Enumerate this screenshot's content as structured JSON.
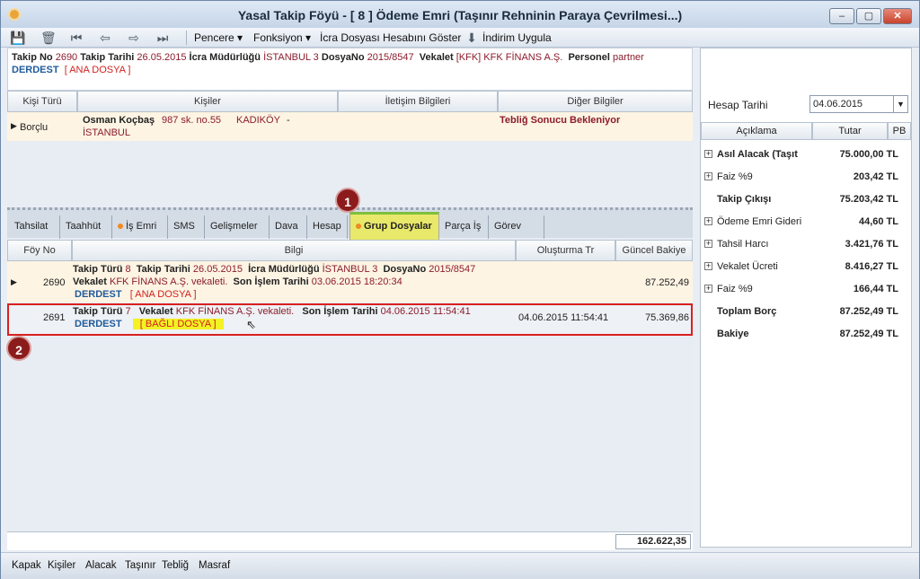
{
  "window": {
    "title": "Yasal Takip Föyü - [ 8 ] Ödeme Emri (Taşınır Rehninin Paraya Çevrilmesi...)"
  },
  "toolbar": {
    "menus": [
      "Pencere ▾",
      "Fonksiyon ▾",
      "İcra Dosyası Hesabını Göster",
      "İndirim Uygula"
    ]
  },
  "info": {
    "takip_no_label": "Takip No",
    "takip_no": "2690",
    "takip_tarihi_label": "Takip Tarihi",
    "takip_tarihi": "26.05.2015",
    "icra_label": "İcra Müdürlüğü",
    "icra": "İSTANBUL 3",
    "dosya_label": "DosyaNo",
    "dosya": "2015/8547",
    "vekalet_label": "Vekalet",
    "vekalet": "[KFK] KFK FİNANS A.Ş.",
    "personel_label": "Personel",
    "personel": "partner",
    "durum": "DERDEST",
    "ana_dosya": "[ ANA DOSYA ]"
  },
  "parties": {
    "headers": [
      "Kişi Türü",
      "Kişiler",
      "İletişim Bilgileri",
      "Diğer Bilgiler"
    ],
    "row": {
      "type": "Borçlu",
      "name": "Osman Koçbaş",
      "address": "987 sk. no.55",
      "district": "KADIKÖY",
      "dash": "-",
      "city": "İSTANBUL",
      "other": "Tebliğ Sonucu Bekleniyor"
    }
  },
  "tabs": [
    "Tahsilat",
    "Taahhüt",
    "İş Emri",
    "SMS",
    "Gelişmeler",
    "Dava",
    "Hesap",
    "Grup Dosyalar",
    "Parça İş",
    "Görev"
  ],
  "badges": {
    "b1": "1",
    "b2": "2"
  },
  "group": {
    "headers": [
      "Föy No",
      "Bilgi",
      "Oluşturma Tr",
      "Güncel Bakiye"
    ],
    "rows": [
      {
        "foy": "2690",
        "takip_turu_label": "Takip Türü",
        "takip_turu": "8",
        "takip_tarihi_label": "Takip Tarihi",
        "takip_tarihi": "26.05.2015",
        "icra_label": "İcra Müdürlüğü",
        "icra": "İSTANBUL 3",
        "dosya_label": "DosyaNo",
        "dosya": "2015/8547",
        "vekalet_label": "Vekalet",
        "vekalet": "KFK FİNANS A.Ş. vekaleti.",
        "son_label": "Son İşlem Tarihi",
        "son": "03.06.2015 18:20:34",
        "durum": "DERDEST",
        "tag": "[ ANA DOSYA ]",
        "created": "",
        "balance": "87.252,49"
      },
      {
        "foy": "2691",
        "takip_turu_label": "Takip Türü",
        "takip_turu": "7",
        "vekalet_label": "Vekalet",
        "vekalet": "KFK FİNANS A.Ş. vekaleti.",
        "son_label": "Son İşlem Tarihi",
        "son": "04.06.2015 11:54:41",
        "durum": "DERDEST",
        "tag": "[ BAĞLI DOSYA ]",
        "created": "04.06.2015 11:54:41",
        "balance": "75.369,86"
      }
    ],
    "total": "162.622,35"
  },
  "account": {
    "date_label": "Hesap Tarihi",
    "date": "04.06.2015",
    "headers": [
      "Açıklama",
      "Tutar",
      "PB"
    ],
    "rows": [
      {
        "plus": true,
        "desc": "Asıl Alacak (Taşıt",
        "amount": "75.000,00",
        "cur": "TL",
        "bold": true
      },
      {
        "plus": true,
        "desc": "Faiz %9",
        "amount": "203,42",
        "cur": "TL",
        "bold": false
      },
      {
        "plus": false,
        "desc": "Takip Çıkışı",
        "amount": "75.203,42",
        "cur": "TL",
        "bold": true
      },
      {
        "plus": true,
        "desc": "Ödeme Emri Gideri",
        "amount": "44,60",
        "cur": "TL",
        "bold": false
      },
      {
        "plus": true,
        "desc": "Tahsil Harcı",
        "amount": "3.421,76",
        "cur": "TL",
        "bold": false
      },
      {
        "plus": true,
        "desc": "Vekalet Ücreti",
        "amount": "8.416,27",
        "cur": "TL",
        "bold": false
      },
      {
        "plus": true,
        "desc": "Faiz %9",
        "amount": "166,44",
        "cur": "TL",
        "bold": false
      },
      {
        "plus": false,
        "desc": "Toplam Borç",
        "amount": "87.252,49",
        "cur": "TL",
        "bold": true
      },
      {
        "plus": false,
        "desc": "Bakiye",
        "amount": "87.252,49",
        "cur": "TL",
        "bold": true
      }
    ]
  },
  "statusbar": [
    "Kapak",
    "Kişiler",
    "Alacak",
    "Taşınır",
    "Tebliğ",
    "Masraf"
  ]
}
